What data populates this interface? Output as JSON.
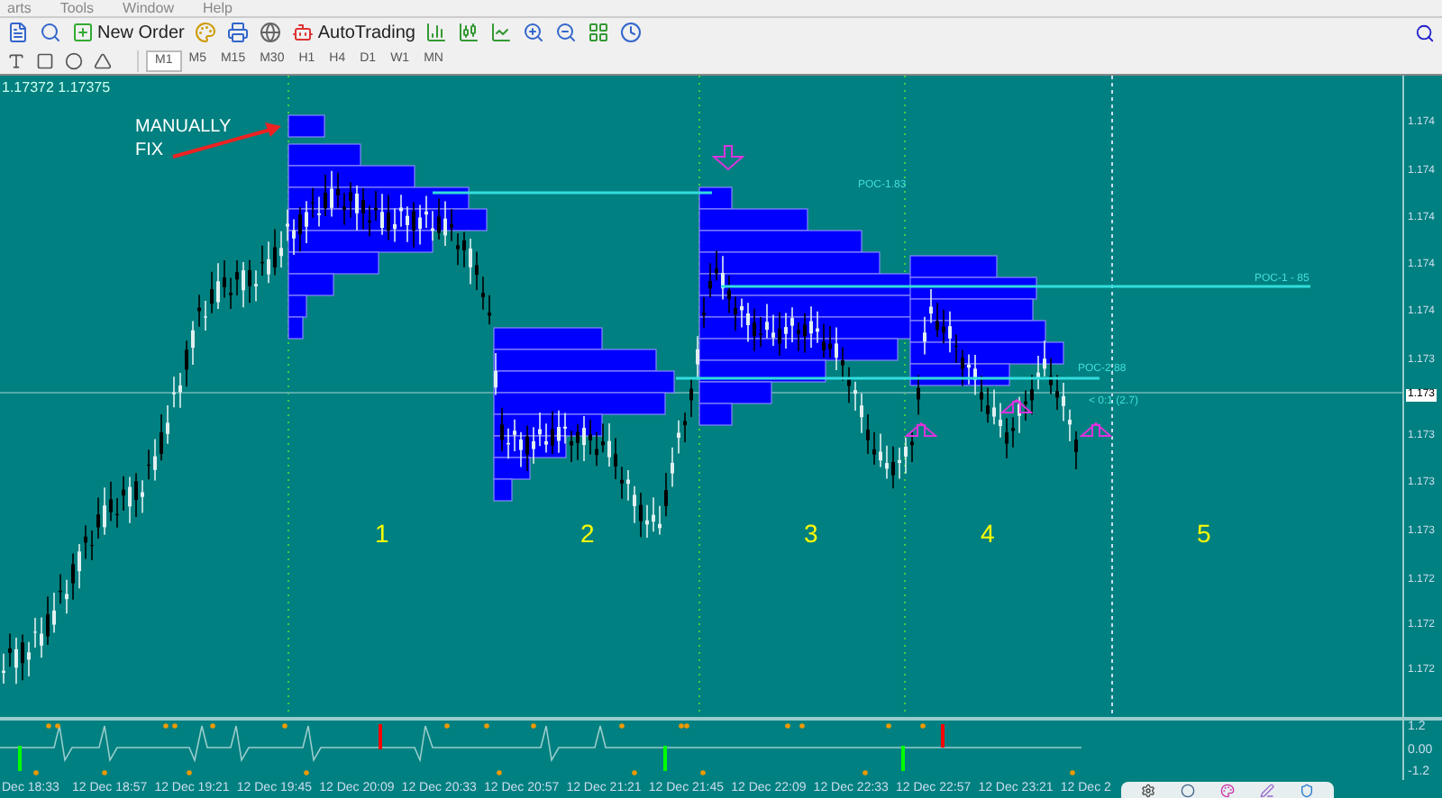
{
  "menu": [
    "arts",
    "Tools",
    "Window",
    "Help"
  ],
  "toolbar": {
    "buttons": [
      {
        "kind": "order",
        "label": "New Order"
      },
      {
        "kind": "auto",
        "label": "AutoTrading"
      }
    ]
  },
  "timeframes": [
    {
      "label": "M1",
      "selected": true
    },
    {
      "label": "M5",
      "selected": false
    },
    {
      "label": "M15",
      "selected": false
    },
    {
      "label": "M30",
      "selected": false
    },
    {
      "label": "H1",
      "selected": false
    },
    {
      "label": "H4",
      "selected": false
    },
    {
      "label": "D1",
      "selected": false
    },
    {
      "label": "W1",
      "selected": false
    },
    {
      "label": "MN",
      "selected": false
    }
  ],
  "chart": {
    "quote": "1.17372 1.17375",
    "annotation": [
      "MANUALLY",
      "FIX"
    ],
    "session_labels": [
      "1",
      "2",
      "3",
      "4",
      "5"
    ],
    "poc_labels": [
      "POC-1.83",
      "POC-1 - 85",
      "POC-2.88",
      "< 0:1 (2.7)"
    ],
    "price_axis": [
      "1.174",
      "1.174",
      "1.174",
      "1.174",
      "1.174",
      "1.173",
      "1.173",
      "1.173",
      "1.173",
      "1.172",
      "1.172",
      "1.172"
    ],
    "current_price": "1.173"
  },
  "indicator": {
    "axis": [
      "1.2",
      "0.00",
      "-1.2"
    ]
  },
  "time_axis": [
    "Dec 18:33",
    "12 Dec 18:57",
    "12 Dec 19:21",
    "12 Dec 19:45",
    "12 Dec 20:09",
    "12 Dec 20:33",
    "12 Dec 20:57",
    "12 Dec 21:21",
    "12 Dec 21:45",
    "12 Dec 22:09",
    "12 Dec 22:33",
    "12 Dec 22:57",
    "12 Dec 23:21",
    "12 Dec 2"
  ]
}
